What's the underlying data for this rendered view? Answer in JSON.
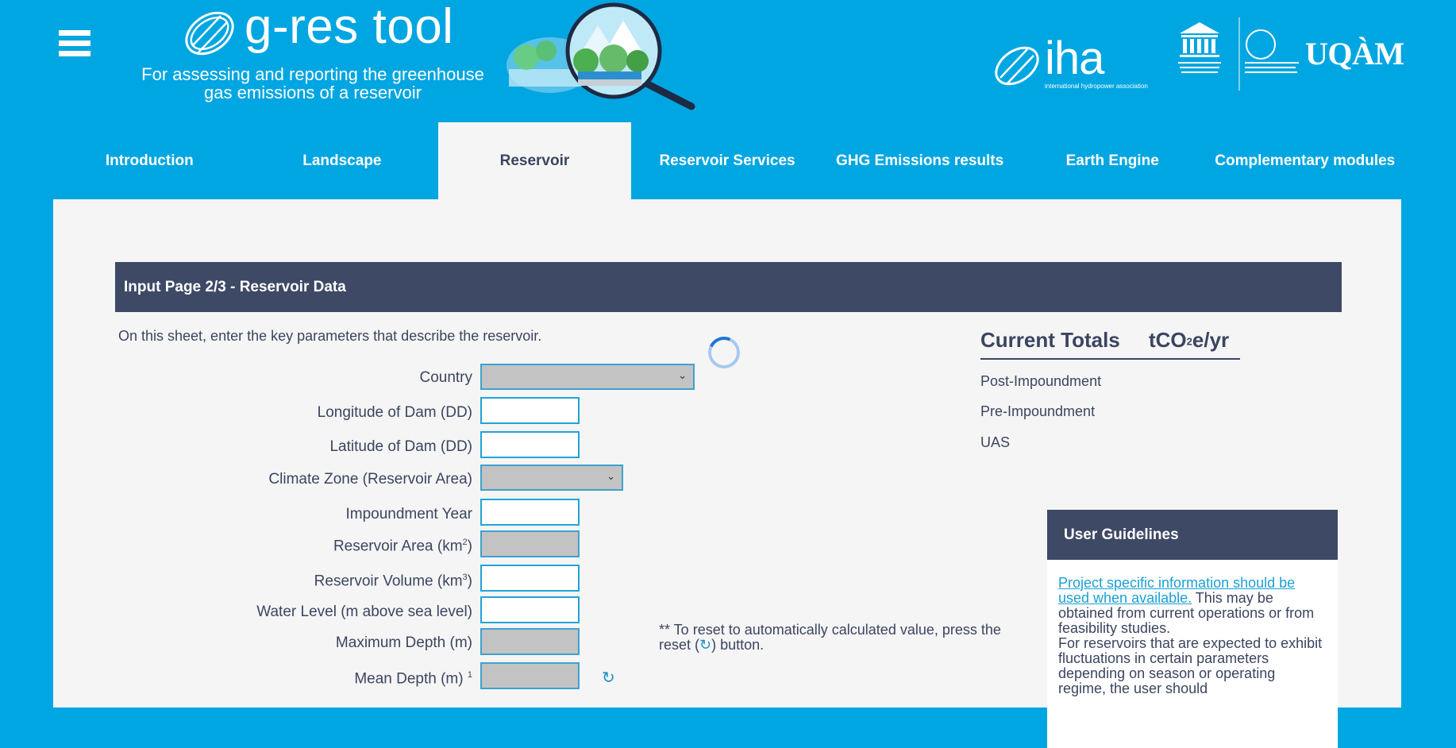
{
  "header": {
    "menu_icon": "hamburger-menu-icon",
    "app_name": "g-res tool",
    "tagline": "For assessing and reporting the greenhouse gas emissions of a reservoir",
    "partner_1": "iha",
    "partner_1_sub": "international hydropower association",
    "partner_3": "UQÀM"
  },
  "tabs": [
    {
      "label": "Introduction",
      "active": false
    },
    {
      "label": "Landscape",
      "active": false
    },
    {
      "label": "Reservoir",
      "active": true
    },
    {
      "label": "Reservoir Services",
      "active": false
    },
    {
      "label": "GHG Emissions results",
      "active": false
    },
    {
      "label": "Earth Engine",
      "active": false
    },
    {
      "label": "Complementary modules",
      "active": false
    }
  ],
  "section": {
    "title": "Input Page 2/3 - Reservoir Data",
    "intro": "On this sheet, enter the key parameters that describe the reservoir."
  },
  "fields": {
    "country": {
      "label": "Country",
      "value": ""
    },
    "longitude": {
      "label": "Longitude of Dam (DD)",
      "value": ""
    },
    "latitude": {
      "label": "Latitude of Dam (DD)",
      "value": ""
    },
    "climate_zone": {
      "label": "Climate Zone (Reservoir Area)",
      "value": ""
    },
    "impoundment_year": {
      "label": "Impoundment Year",
      "value": ""
    },
    "reservoir_area": {
      "label": "Reservoir Area (km",
      "sup": "2",
      "tail": ")",
      "value": ""
    },
    "reservoir_volume": {
      "label": "Reservoir Volume (km",
      "sup": "3",
      "tail": ")",
      "value": ""
    },
    "water_level": {
      "label": "Water Level (m above sea level)",
      "value": ""
    },
    "max_depth": {
      "label": "Maximum Depth (m)",
      "value": ""
    },
    "mean_depth": {
      "label": "Mean Depth (m)",
      "sup": "1",
      "value": ""
    }
  },
  "reset_note": {
    "before": "** To reset to automatically calculated value, press the reset (",
    "icon": "↻",
    "after": ") button."
  },
  "totals": {
    "title": "Current Totals",
    "unit_pre": "tCO",
    "unit_sub": "2",
    "unit_post": "e/yr",
    "rows": [
      "Post-Impoundment",
      "Pre-Impoundment",
      "UAS"
    ]
  },
  "guidelines": {
    "title": "User Guidelines",
    "link": "Project specific information should be used when available.",
    "text_1": " This may be obtained from current operations or from feasibility studies.",
    "text_2": "For reservoirs that are expected to exhibit fluctuations in certain parameters depending on season or operating regime, the user should"
  }
}
